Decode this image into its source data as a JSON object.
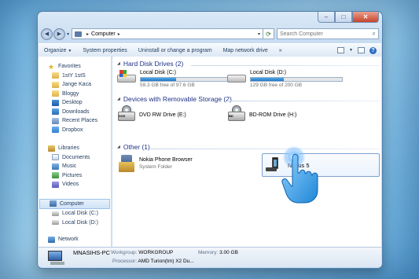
{
  "window": {
    "caption_buttons": [
      "–",
      "□",
      "✕"
    ]
  },
  "address": {
    "back_glyph": "◀",
    "forward_glyph": "▶",
    "path_segment": "Computer",
    "separator": "▸",
    "refresh_glyph": "⟳"
  },
  "search": {
    "placeholder": "Search Computer",
    "icon": "search-icon"
  },
  "toolbar": {
    "organize": "Organize",
    "system_properties": "System properties",
    "uninstall": "Uninstall or change a program",
    "map_drive": "Map network drive",
    "more": "»",
    "help": "?"
  },
  "sidebar": {
    "favorites": {
      "label": "Favorites",
      "items": [
        "1stY 1stS",
        "Jange Kaca",
        "Bloggy",
        "Desktop",
        "Downloads",
        "Recent Places",
        "Dropbox"
      ]
    },
    "libraries": {
      "label": "Libraries",
      "items": [
        "Documents",
        "Music",
        "Pictures",
        "Videos"
      ]
    },
    "computer": {
      "label": "Computer",
      "items": [
        "Local Disk (C:)",
        "Local Disk (D:)"
      ]
    },
    "network": {
      "label": "Network"
    }
  },
  "groups": {
    "hdd": {
      "title": "Hard Disk Drives (2)",
      "drives": [
        {
          "name": "Local Disk (C:)",
          "free": "59.3 GB free of 97.6 GB",
          "used_fraction": 0.39
        },
        {
          "name": "Local Disk (D:)",
          "free": "129 GB free of 200 GB",
          "used_fraction": 0.36
        }
      ]
    },
    "removable": {
      "title": "Devices with Removable Storage (2)",
      "devices": [
        {
          "name": "DVD RW Drive (E:)",
          "badge": "DVD"
        },
        {
          "name": "BD-ROM Drive (H:)",
          "badge": "BD"
        }
      ]
    },
    "other": {
      "title": "Other (1)",
      "items": [
        {
          "name": "Nokia Phone Browser",
          "type": "System Folder"
        },
        {
          "name": "Nexus 5"
        }
      ]
    }
  },
  "details": {
    "computer_name": "MNASIHS-PC",
    "workgroup_label": "Workgroup:",
    "workgroup": "WORKGROUP",
    "memory_label": "Memory:",
    "memory": "3.00 GB",
    "processor_label": "Processor:",
    "processor": "AMD Turion(tm) X2 Du..."
  },
  "colors": {
    "accent": "#2677c4",
    "group_heading": "#1e3287",
    "selection_border": "#7da2ce"
  }
}
